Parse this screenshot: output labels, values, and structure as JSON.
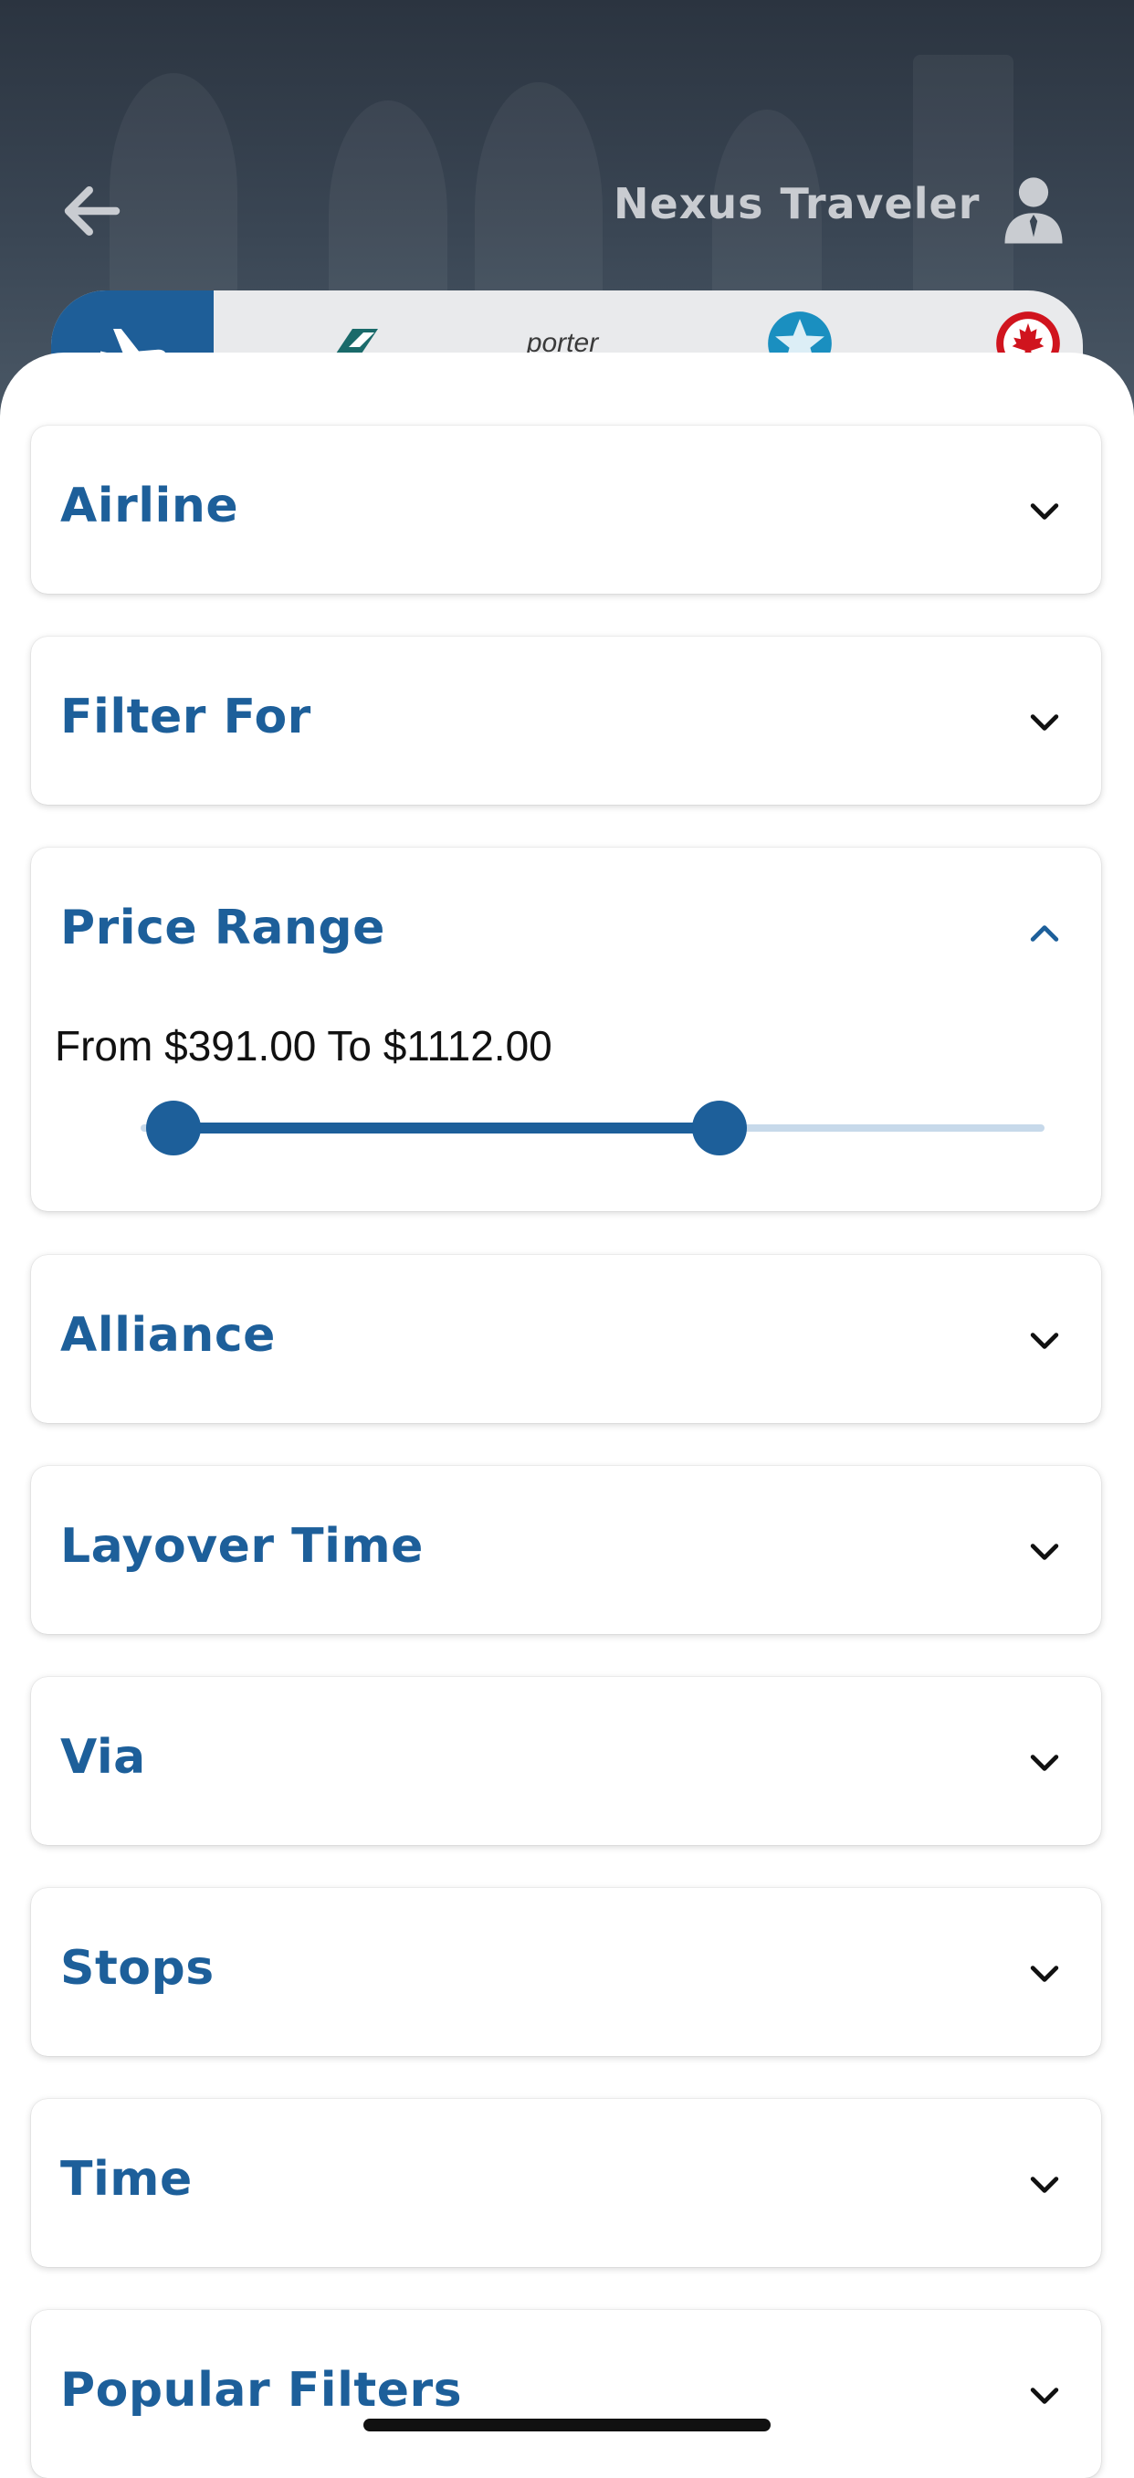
{
  "header": {
    "brand_word1": "Nexus",
    "brand_word2": "Traveler",
    "airline_logos": [
      "airline-logo-teal",
      "porter",
      "airline-logo-star",
      "air-canada-maple-leaf"
    ]
  },
  "filters": [
    {
      "key": "airline",
      "title": "Airline",
      "expanded": false
    },
    {
      "key": "filter_for",
      "title": "Filter For",
      "expanded": false
    },
    {
      "key": "price_range",
      "title": "Price Range",
      "expanded": true
    },
    {
      "key": "alliance",
      "title": "Alliance",
      "expanded": false
    },
    {
      "key": "layover_time",
      "title": "Layover Time",
      "expanded": false
    },
    {
      "key": "via",
      "title": "Via",
      "expanded": false
    },
    {
      "key": "stops",
      "title": "Stops",
      "expanded": false
    },
    {
      "key": "time",
      "title": "Time",
      "expanded": false
    },
    {
      "key": "popular_filters",
      "title": "Popular Filters",
      "expanded": false
    }
  ],
  "price_range": {
    "from_label": "From",
    "from_value": "$391.00",
    "to_label": "To",
    "to_value": "$1112.00",
    "slider_low_fraction": 0.0,
    "slider_high_fraction": 0.64
  },
  "colors": {
    "accent": "#1d5f9a",
    "track": "#c7d9ea",
    "header_bg": "#2b3440"
  },
  "icons": {
    "back": "arrow-left-icon",
    "user": "user-icon",
    "plane": "plane-icon",
    "collapsed": "chevron-down-icon",
    "expanded": "chevron-up-icon"
  }
}
